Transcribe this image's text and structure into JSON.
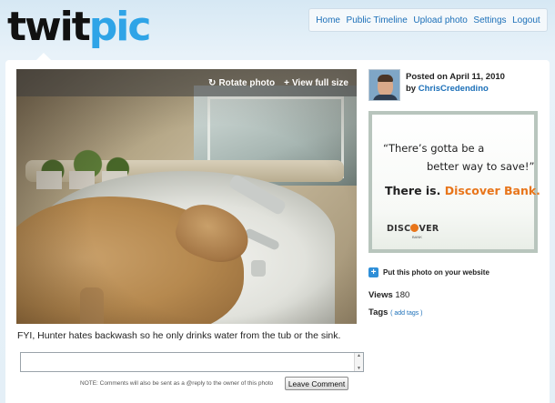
{
  "logo": {
    "part1": "twit",
    "part2": "pic"
  },
  "nav": [
    {
      "label": "Home"
    },
    {
      "label": "Public Timeline"
    },
    {
      "label": "Upload photo"
    },
    {
      "label": "Settings"
    },
    {
      "label": "Logout"
    }
  ],
  "photo": {
    "rotate_label": "Rotate photo",
    "full_size_label": "View full size",
    "caption": "FYI, Hunter hates backwash so he only drinks water from the tub or the sink."
  },
  "comment": {
    "note": "NOTE: Comments will also be sent as a @reply to the owner of this photo",
    "button_label": "Leave Comment"
  },
  "post": {
    "posted_on": "Posted on April 11, 2010",
    "by": "by",
    "username": "ChrisCredendino"
  },
  "ad": {
    "line1": "“There’s gotta be a",
    "line2": "better way to save!”",
    "line3a": "There is. ",
    "line3b": "Discover Bank.",
    "brand_a": "DISC",
    "brand_b": "VER",
    "brand_sub": "BANK",
    "accent_color": "#e8751a"
  },
  "sidebar": {
    "put_label": "Put this photo on your website",
    "views_label": "Views",
    "views_count": "180",
    "tags_label": "Tags",
    "add_tags": "( add tags )"
  }
}
